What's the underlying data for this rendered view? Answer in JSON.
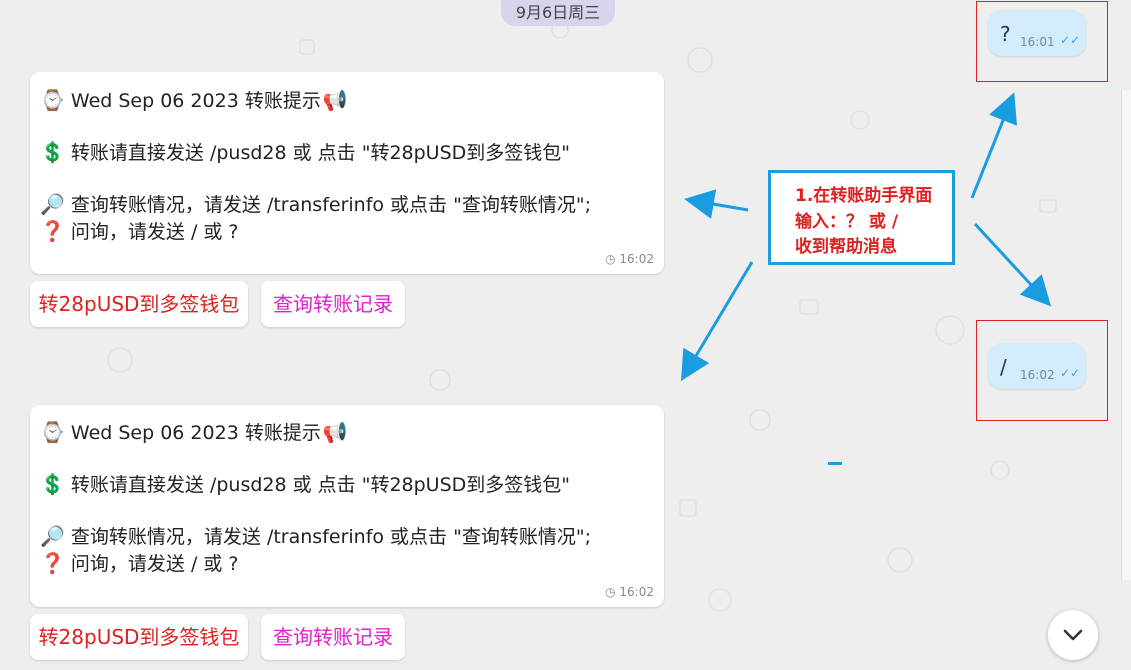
{
  "date_separator": "9月6日周三",
  "bot_messages": [
    {
      "line1": "Wed Sep 06 2023 转账提示",
      "line2": "转账请直接发送 /pusd28 或 点击 \"转28pUSD到多签钱包\"",
      "line3": "查询转账情况，请发送 /transferinfo 或点击 \"查询转账情况\";",
      "line4": "问询，请发送 / 或 ?",
      "time": "16:02",
      "buttons": [
        "转28pUSD到多签钱包",
        "查询转账记录"
      ]
    },
    {
      "line1": "Wed Sep 06 2023 转账提示",
      "line2": "转账请直接发送 /pusd28 或 点击 \"转28pUSD到多签钱包\"",
      "line3": "查询转账情况，请发送 /transferinfo 或点击 \"查询转账情况\";",
      "line4": "问询，请发送 / 或 ?",
      "time": "16:02",
      "buttons": [
        "转28pUSD到多签钱包",
        "查询转账记录"
      ]
    }
  ],
  "user_messages": [
    {
      "text": "?",
      "time": "16:01"
    },
    {
      "text": "/",
      "time": "16:02"
    }
  ],
  "annotation": {
    "line1": "1.在转账助手界面",
    "line2": "输入：？ 或 /",
    "line3": "收到帮助消息"
  },
  "icons": [
    "watch-icon",
    "megaphone-icon",
    "dollar-icon",
    "magnifier-icon",
    "question-icon",
    "clock-icon",
    "double-check-icon",
    "chevron-down-icon"
  ],
  "colors": {
    "annotation_border": "#1a9de0",
    "annotation_text": "#e02020",
    "button_red": "#e02020",
    "button_pink": "#e020c8",
    "user_bubble": "#d3ecfb"
  }
}
